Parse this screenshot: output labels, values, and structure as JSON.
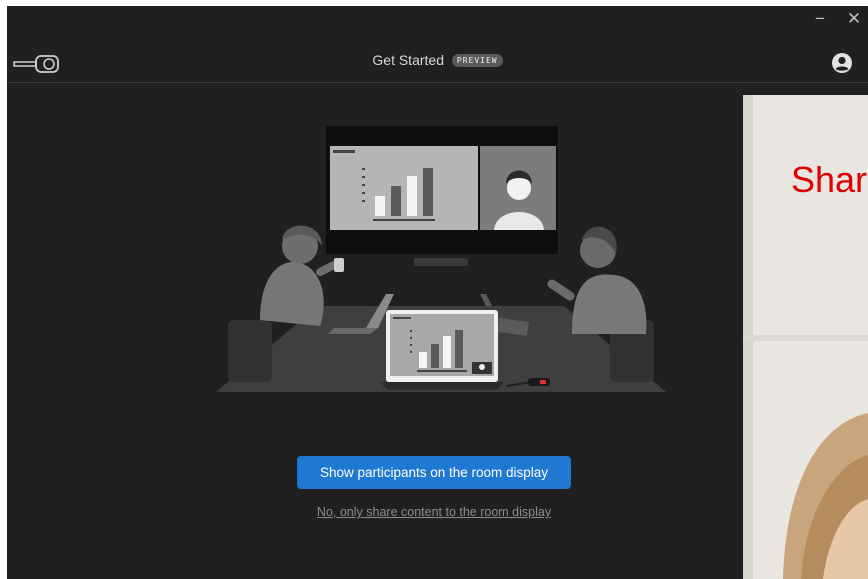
{
  "window": {
    "title": "Get Started",
    "badge": "PREVIEW",
    "minimize_glyph": "−",
    "close_glyph": "✕"
  },
  "icons": {
    "app_logo": "clickshare-button-icon",
    "account": "account-circle-icon"
  },
  "actions": {
    "primary_label": "Show participants on the room display",
    "secondary_label": "No, only share content to the room display"
  },
  "preview": {
    "text": "Shar"
  },
  "colors": {
    "background": "#202020",
    "primary_button": "#1f78d1",
    "preview_text": "#e00000"
  }
}
